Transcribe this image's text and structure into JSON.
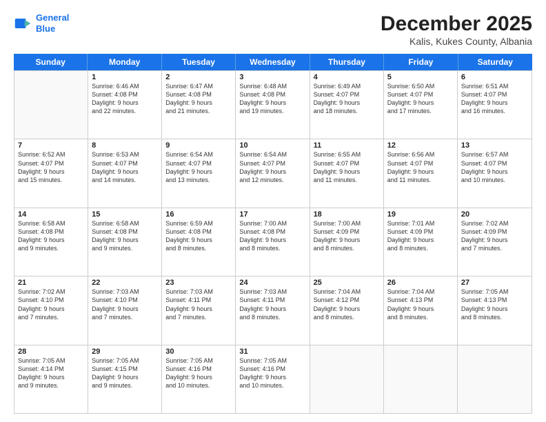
{
  "logo": {
    "line1": "General",
    "line2": "Blue"
  },
  "title": "December 2025",
  "subtitle": "Kalis, Kukes County, Albania",
  "days": [
    "Sunday",
    "Monday",
    "Tuesday",
    "Wednesday",
    "Thursday",
    "Friday",
    "Saturday"
  ],
  "rows": [
    [
      {
        "day": "",
        "info": ""
      },
      {
        "day": "1",
        "info": "Sunrise: 6:46 AM\nSunset: 4:08 PM\nDaylight: 9 hours\nand 22 minutes."
      },
      {
        "day": "2",
        "info": "Sunrise: 6:47 AM\nSunset: 4:08 PM\nDaylight: 9 hours\nand 21 minutes."
      },
      {
        "day": "3",
        "info": "Sunrise: 6:48 AM\nSunset: 4:08 PM\nDaylight: 9 hours\nand 19 minutes."
      },
      {
        "day": "4",
        "info": "Sunrise: 6:49 AM\nSunset: 4:07 PM\nDaylight: 9 hours\nand 18 minutes."
      },
      {
        "day": "5",
        "info": "Sunrise: 6:50 AM\nSunset: 4:07 PM\nDaylight: 9 hours\nand 17 minutes."
      },
      {
        "day": "6",
        "info": "Sunrise: 6:51 AM\nSunset: 4:07 PM\nDaylight: 9 hours\nand 16 minutes."
      }
    ],
    [
      {
        "day": "7",
        "info": "Sunrise: 6:52 AM\nSunset: 4:07 PM\nDaylight: 9 hours\nand 15 minutes."
      },
      {
        "day": "8",
        "info": "Sunrise: 6:53 AM\nSunset: 4:07 PM\nDaylight: 9 hours\nand 14 minutes."
      },
      {
        "day": "9",
        "info": "Sunrise: 6:54 AM\nSunset: 4:07 PM\nDaylight: 9 hours\nand 13 minutes."
      },
      {
        "day": "10",
        "info": "Sunrise: 6:54 AM\nSunset: 4:07 PM\nDaylight: 9 hours\nand 12 minutes."
      },
      {
        "day": "11",
        "info": "Sunrise: 6:55 AM\nSunset: 4:07 PM\nDaylight: 9 hours\nand 11 minutes."
      },
      {
        "day": "12",
        "info": "Sunrise: 6:56 AM\nSunset: 4:07 PM\nDaylight: 9 hours\nand 11 minutes."
      },
      {
        "day": "13",
        "info": "Sunrise: 6:57 AM\nSunset: 4:07 PM\nDaylight: 9 hours\nand 10 minutes."
      }
    ],
    [
      {
        "day": "14",
        "info": "Sunrise: 6:58 AM\nSunset: 4:08 PM\nDaylight: 9 hours\nand 9 minutes."
      },
      {
        "day": "15",
        "info": "Sunrise: 6:58 AM\nSunset: 4:08 PM\nDaylight: 9 hours\nand 9 minutes."
      },
      {
        "day": "16",
        "info": "Sunrise: 6:59 AM\nSunset: 4:08 PM\nDaylight: 9 hours\nand 8 minutes."
      },
      {
        "day": "17",
        "info": "Sunrise: 7:00 AM\nSunset: 4:08 PM\nDaylight: 9 hours\nand 8 minutes."
      },
      {
        "day": "18",
        "info": "Sunrise: 7:00 AM\nSunset: 4:09 PM\nDaylight: 9 hours\nand 8 minutes."
      },
      {
        "day": "19",
        "info": "Sunrise: 7:01 AM\nSunset: 4:09 PM\nDaylight: 9 hours\nand 8 minutes."
      },
      {
        "day": "20",
        "info": "Sunrise: 7:02 AM\nSunset: 4:09 PM\nDaylight: 9 hours\nand 7 minutes."
      }
    ],
    [
      {
        "day": "21",
        "info": "Sunrise: 7:02 AM\nSunset: 4:10 PM\nDaylight: 9 hours\nand 7 minutes."
      },
      {
        "day": "22",
        "info": "Sunrise: 7:03 AM\nSunset: 4:10 PM\nDaylight: 9 hours\nand 7 minutes."
      },
      {
        "day": "23",
        "info": "Sunrise: 7:03 AM\nSunset: 4:11 PM\nDaylight: 9 hours\nand 7 minutes."
      },
      {
        "day": "24",
        "info": "Sunrise: 7:03 AM\nSunset: 4:11 PM\nDaylight: 9 hours\nand 8 minutes."
      },
      {
        "day": "25",
        "info": "Sunrise: 7:04 AM\nSunset: 4:12 PM\nDaylight: 9 hours\nand 8 minutes."
      },
      {
        "day": "26",
        "info": "Sunrise: 7:04 AM\nSunset: 4:13 PM\nDaylight: 9 hours\nand 8 minutes."
      },
      {
        "day": "27",
        "info": "Sunrise: 7:05 AM\nSunset: 4:13 PM\nDaylight: 9 hours\nand 8 minutes."
      }
    ],
    [
      {
        "day": "28",
        "info": "Sunrise: 7:05 AM\nSunset: 4:14 PM\nDaylight: 9 hours\nand 9 minutes."
      },
      {
        "day": "29",
        "info": "Sunrise: 7:05 AM\nSunset: 4:15 PM\nDaylight: 9 hours\nand 9 minutes."
      },
      {
        "day": "30",
        "info": "Sunrise: 7:05 AM\nSunset: 4:16 PM\nDaylight: 9 hours\nand 10 minutes."
      },
      {
        "day": "31",
        "info": "Sunrise: 7:05 AM\nSunset: 4:16 PM\nDaylight: 9 hours\nand 10 minutes."
      },
      {
        "day": "",
        "info": ""
      },
      {
        "day": "",
        "info": ""
      },
      {
        "day": "",
        "info": ""
      }
    ]
  ]
}
